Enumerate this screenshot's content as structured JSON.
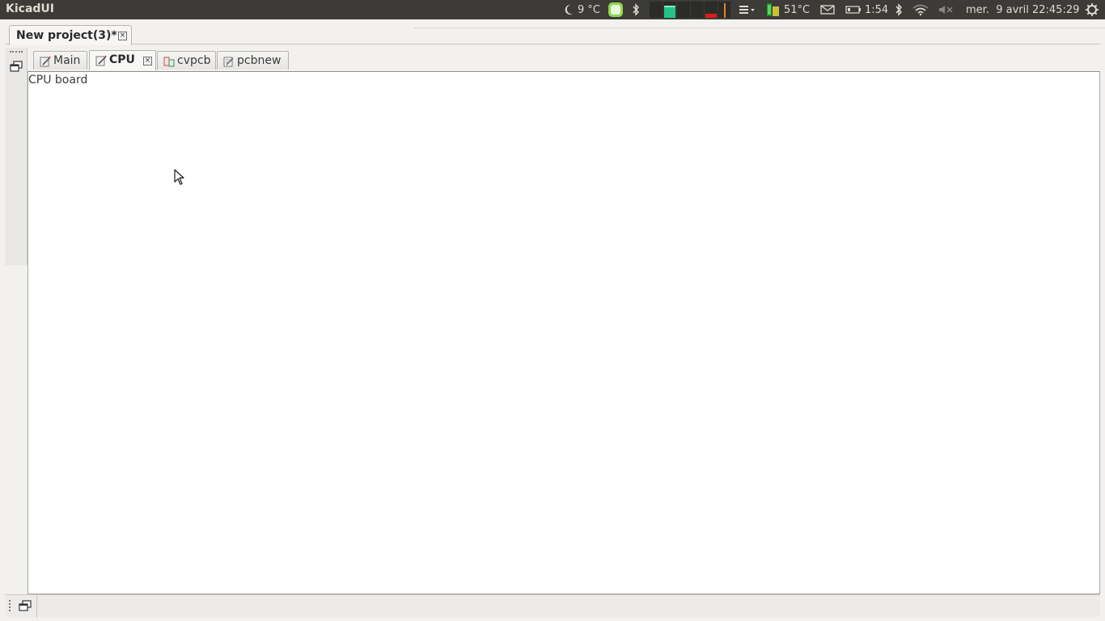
{
  "top_panel": {
    "app_title": "KicadUI",
    "weather": "9 °C",
    "cpu_temp": "51°C",
    "battery_time": "1:54",
    "datetime": "mer.  9 avril 22:45:29",
    "icons": [
      "moon-icon",
      "evernote-icon",
      "bluetooth-icon",
      "system-monitor-icon",
      "menu-icon",
      "temperature-sensor-icon",
      "mail-icon",
      "battery-icon",
      "bluetooth-icon",
      "wifi-icon",
      "volume-muted-icon",
      "session-gear-icon"
    ]
  },
  "project_tab": {
    "label": "New project(3)*",
    "close": "×"
  },
  "doc_tabs": [
    {
      "label": "Main",
      "icon": "schematic-icon"
    },
    {
      "label": "CPU",
      "icon": "schematic-icon",
      "active": true,
      "close": "×"
    },
    {
      "label": "cvpcb",
      "icon": "cvpcb-icon"
    },
    {
      "label": "pcbnew",
      "icon": "pcbnew-icon"
    }
  ],
  "content": {
    "text": "CPU board"
  },
  "colors": {
    "panel_bg": "#3c3b37",
    "panel_text": "#dfdbd2",
    "window_bg": "#f2f1f0",
    "content_bg": "#ffffff"
  }
}
